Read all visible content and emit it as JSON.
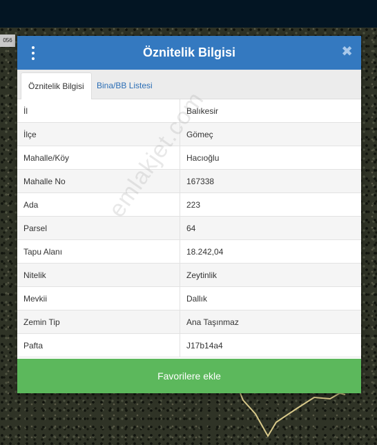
{
  "map": {
    "tag": "056"
  },
  "dialog": {
    "title": "Öznitelik Bilgisi",
    "close_glyph": "✖",
    "tabs": [
      {
        "label": "Öznitelik Bilgisi",
        "active": true
      },
      {
        "label": "Bina/BB Listesi",
        "active": false
      }
    ],
    "rows": [
      {
        "key": "İl",
        "value": "Balıkesir"
      },
      {
        "key": "İlçe",
        "value": "Gömeç"
      },
      {
        "key": "Mahalle/Köy",
        "value": "Hacıoğlu"
      },
      {
        "key": "Mahalle No",
        "value": "167338"
      },
      {
        "key": "Ada",
        "value": "223"
      },
      {
        "key": "Parsel",
        "value": "64"
      },
      {
        "key": "Tapu Alanı",
        "value": "18.242,04"
      },
      {
        "key": "Nitelik",
        "value": "Zeytinlik"
      },
      {
        "key": "Mevkii",
        "value": "Dallık"
      },
      {
        "key": "Zemin Tip",
        "value": "Ana Taşınmaz"
      },
      {
        "key": "Pafta",
        "value": "J17b14a4"
      }
    ],
    "favorite_label": "Favorilere ekle"
  },
  "watermark": "emlakjet.com",
  "colors": {
    "header": "#3479c0",
    "button": "#5cb85c",
    "tab_link": "#2a6db5"
  }
}
